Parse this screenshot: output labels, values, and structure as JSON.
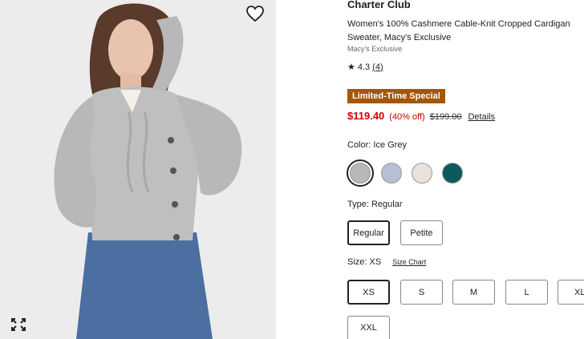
{
  "product": {
    "brand": "Charter Club",
    "title": "Women's 100% Cashmere Cable-Knit Cropped Cardigan Sweater, Macy's Exclusive",
    "exclusive_tag": "Macy's Exclusive",
    "rating": "4.3",
    "review_count": "(4)",
    "promo_badge": "Limited-Time Special",
    "price_sale": "$119.40",
    "price_discount": "(40% off)",
    "price_original": "$199.00",
    "details_link": "Details"
  },
  "color": {
    "label": "Color: Ice Grey",
    "swatches": [
      {
        "name": "Ice Grey",
        "color": "#b9b7b8",
        "selected": true
      },
      {
        "name": "Light Blue",
        "color": "#b7bfd6",
        "selected": false
      },
      {
        "name": "Cream",
        "color": "#e7e3dc",
        "selected": false
      },
      {
        "name": "Teal",
        "color": "#0c5a5c",
        "selected": false
      }
    ]
  },
  "type": {
    "label": "Type: Regular",
    "options": [
      "Regular",
      "Petite"
    ],
    "selected": "Regular"
  },
  "size": {
    "label": "Size: XS",
    "chart_link": "Size Chart",
    "options": [
      "XS",
      "S",
      "M",
      "L",
      "XL",
      "XXL"
    ],
    "selected": "XS"
  },
  "icons": {
    "favorite": "heart-icon",
    "zoom": "expand-icon",
    "star": "star-icon"
  },
  "colors": {
    "promo_bg": "#a2570a",
    "sale_red": "#cc0000"
  }
}
